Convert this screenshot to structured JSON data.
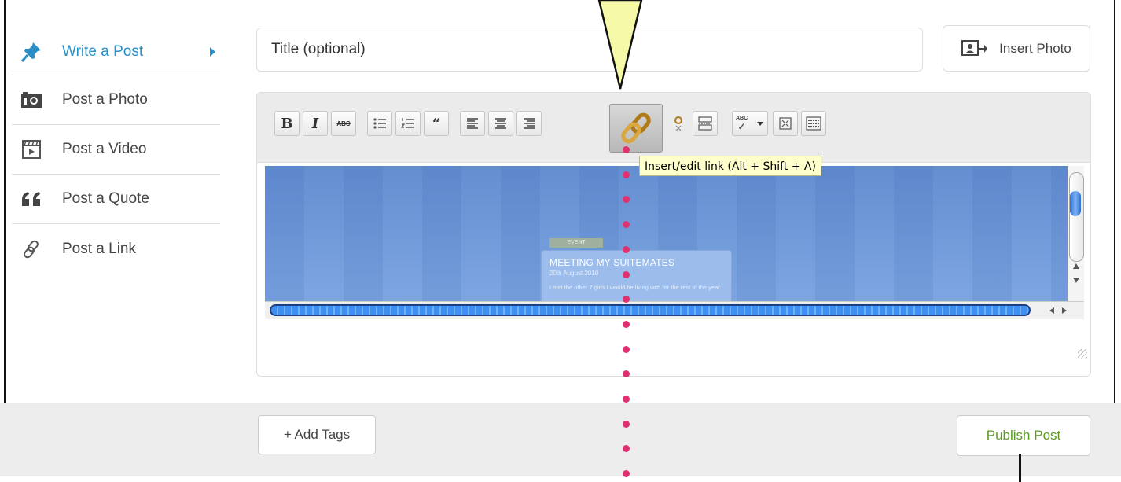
{
  "sidebar": {
    "items": [
      {
        "label": "Write a Post",
        "icon": "pin-icon",
        "active": true
      },
      {
        "label": "Post a Photo",
        "icon": "camera-icon"
      },
      {
        "label": "Post a Video",
        "icon": "video-icon"
      },
      {
        "label": "Post a Quote",
        "icon": "quote-icon"
      },
      {
        "label": "Post a Link",
        "icon": "link-icon"
      }
    ]
  },
  "title_field": {
    "placeholder": "Title (optional)",
    "value": ""
  },
  "insert_photo": {
    "label": "Insert Photo"
  },
  "toolbar": {
    "bold": "B",
    "italic": "I",
    "strike": "ABC",
    "spellcheck_label": "ABC",
    "tooltip": "Insert/edit link (Alt + Shift + A)"
  },
  "preview": {
    "tag": "EVENT",
    "card_title": "MEETING MY SUITEMATES",
    "card_date": "20th August 2010",
    "card_body": "I met the other 7 girls I would be living with for the rest of the year."
  },
  "footer": {
    "add_tags": "+ Add Tags",
    "publish": "Publish Post"
  },
  "colors": {
    "accent": "#2a8fc6",
    "publish": "#5c9a1e",
    "callout_fill": "#f5f9a8",
    "dot": "#e0306f"
  }
}
